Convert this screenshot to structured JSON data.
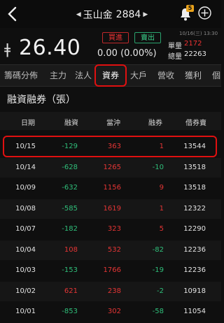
{
  "header": {
    "stock_name": "玉山金",
    "stock_code": "2884",
    "badge": "5"
  },
  "quote": {
    "price": "26.40",
    "change": "0.00 (0.00%)",
    "buy_label": "買進",
    "sell_label": "賣出",
    "timestamp": "10/16(三) 13:30",
    "single_volume_label": "單量",
    "single_volume": "2172",
    "total_volume_label": "總量",
    "total_volume": "22263"
  },
  "tabs": [
    "籌碼分佈",
    "主力",
    "法人",
    "資券",
    "大戶",
    "營收",
    "獲利",
    "個"
  ],
  "active_tab": "資券",
  "section": {
    "title": "融資融券（張）"
  },
  "table": {
    "columns": [
      "日期",
      "融資",
      "當沖",
      "融券",
      "借券賣"
    ],
    "rows": [
      {
        "date": "10/15",
        "margin": "-129",
        "daytrade": "363",
        "short": "1",
        "lend": "13544"
      },
      {
        "date": "10/14",
        "margin": "-628",
        "daytrade": "1265",
        "short": "-10",
        "lend": "13518"
      },
      {
        "date": "10/09",
        "margin": "-632",
        "daytrade": "1156",
        "short": "9",
        "lend": "13518"
      },
      {
        "date": "10/08",
        "margin": "-585",
        "daytrade": "1619",
        "short": "1",
        "lend": "12322"
      },
      {
        "date": "10/07",
        "margin": "-182",
        "daytrade": "323",
        "short": "5",
        "lend": "12290"
      },
      {
        "date": "10/04",
        "margin": "108",
        "daytrade": "532",
        "short": "-82",
        "lend": "12236"
      },
      {
        "date": "10/03",
        "margin": "-153",
        "daytrade": "1766",
        "short": "-19",
        "lend": "12236"
      },
      {
        "date": "10/02",
        "margin": "621",
        "daytrade": "238",
        "short": "-2",
        "lend": "10918"
      },
      {
        "date": "10/01",
        "margin": "-853",
        "daytrade": "302",
        "short": "-58",
        "lend": "11054"
      }
    ]
  },
  "colors": {
    "up": "#e53535",
    "down": "#2fbf7a",
    "highlight": "#e01010"
  },
  "icons": {
    "back": "chevron-left-icon",
    "notify": "bell-icon",
    "add": "plus-circle-icon"
  }
}
